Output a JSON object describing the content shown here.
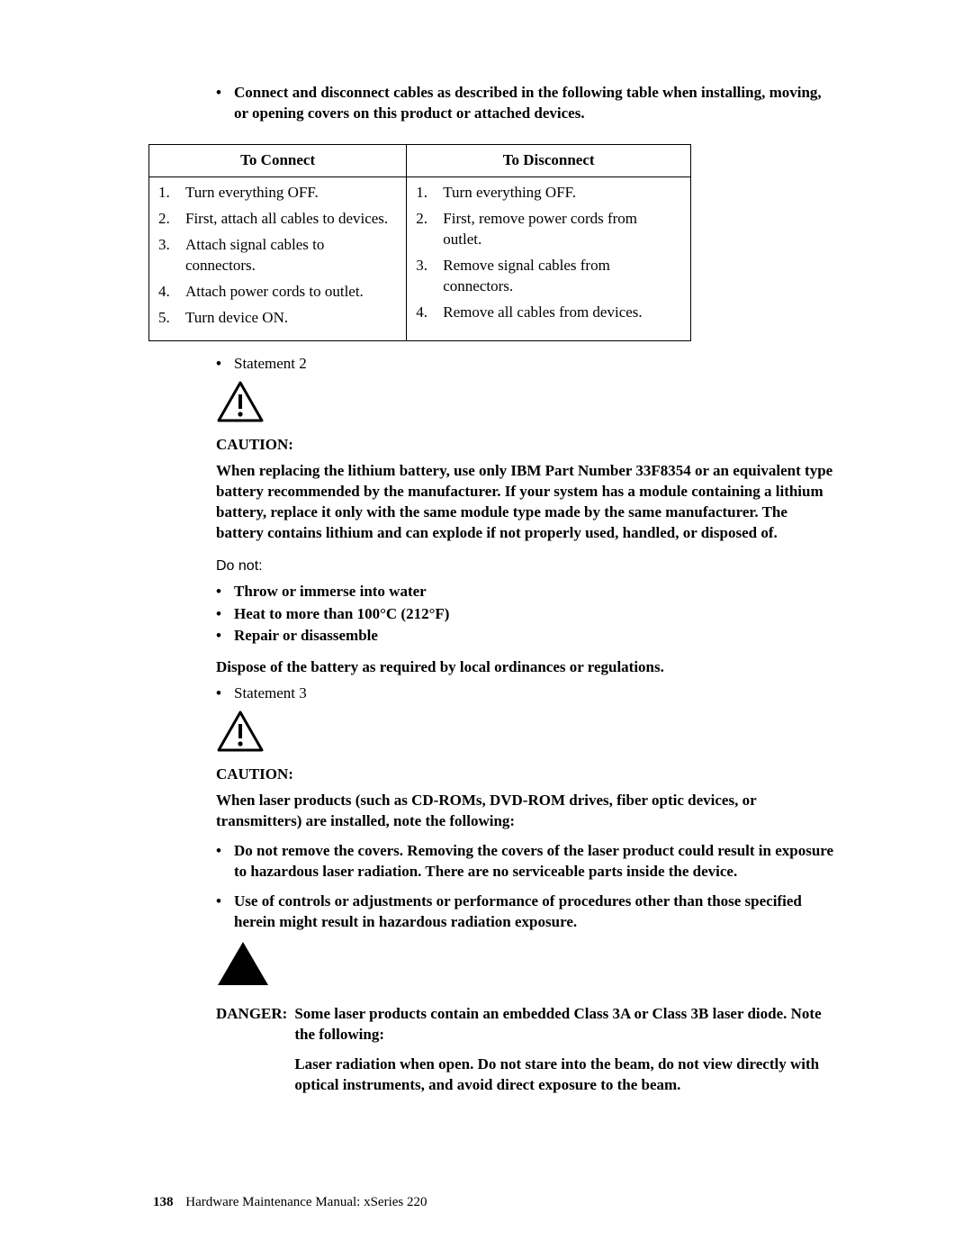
{
  "intro_bullet": "Connect and disconnect cables as described in the following table when installing, moving, or opening covers on this product or attached devices.",
  "table": {
    "connect_header": "To Connect",
    "disconnect_header": "To Disconnect",
    "connect_steps": [
      "Turn everything OFF.",
      "First, attach all cables to devices.",
      "Attach signal cables to connectors.",
      "Attach power cords to outlet.",
      "Turn device ON."
    ],
    "disconnect_steps": [
      "Turn everything OFF.",
      "First, remove power cords from outlet.",
      "Remove signal cables from connectors.",
      "Remove all cables from devices."
    ],
    "nums": [
      "1.",
      "2.",
      "3.",
      "4.",
      "5."
    ]
  },
  "statement2": {
    "label": "Statement 2",
    "caution": "CAUTION:",
    "body": "When replacing the lithium battery, use only IBM Part Number 33F8354 or an equivalent type battery recommended by the manufacturer.  If your system has a module containing a lithium battery, replace it only with the same module type made by the same manufacturer. The battery contains lithium and can explode if not properly used, handled, or disposed of.",
    "donot_heading": "Do not:",
    "donot_items": [
      "Throw or immerse into water",
      "Heat to more than 100°C (212°F)",
      "Repair or disassemble"
    ],
    "dispose": "Dispose of the battery as required by local ordinances or regulations."
  },
  "statement3": {
    "label": "Statement 3",
    "caution": "CAUTION:",
    "intro": "When laser products (such as CD-ROMs, DVD-ROM drives, fiber optic devices, or transmitters) are installed, note the following:",
    "bullets": [
      "Do not remove the covers.  Removing the covers of the laser product could result in exposure to hazardous laser radiation.  There are no serviceable parts inside the device.",
      "Use of controls or adjustments or performance of procedures other than those specified herein might result in hazardous radiation exposure."
    ],
    "danger_label": "DANGER:",
    "danger_head": "Some laser products contain an embedded Class 3A or Class 3B laser diode.  Note the following:",
    "danger_body": "Laser radiation when open.  Do not stare into the beam, do not view directly with optical instruments, and avoid direct exposure to the beam."
  },
  "footer": {
    "page_number": "138",
    "title": "Hardware Maintenance Manual: xSeries 220"
  }
}
